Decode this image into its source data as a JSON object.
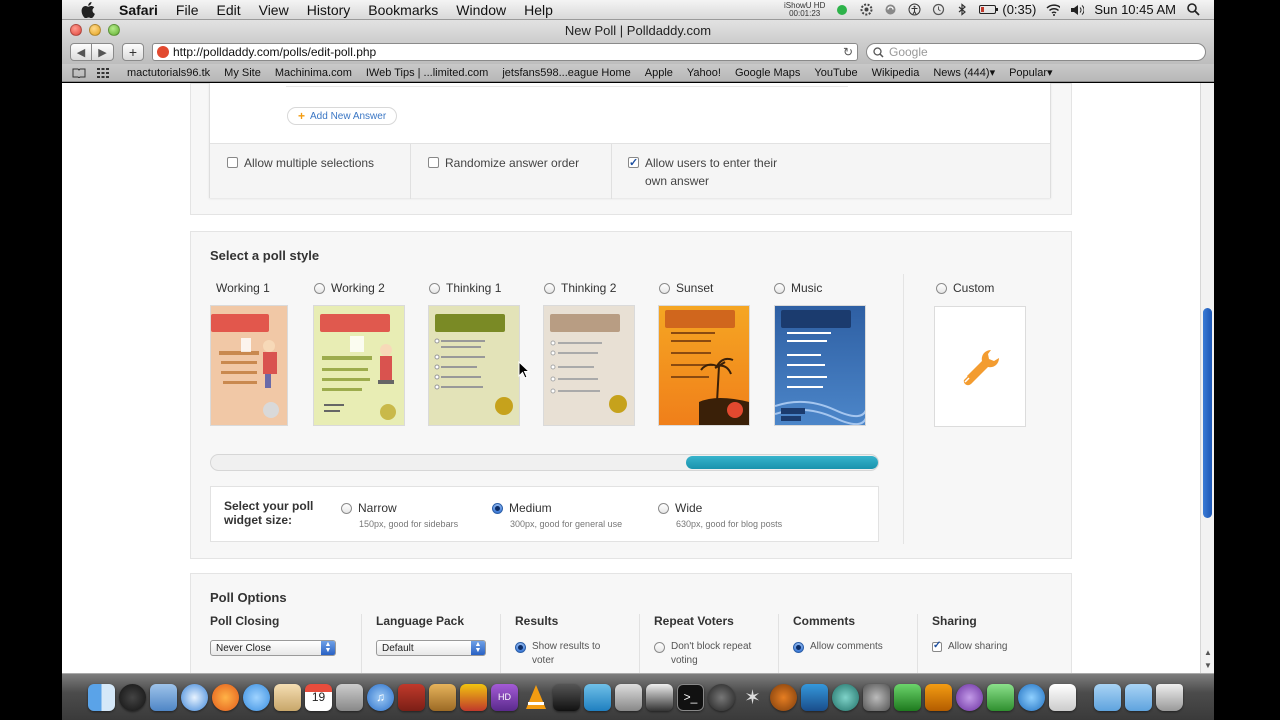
{
  "menubar": {
    "app": "Safari",
    "items": [
      "File",
      "Edit",
      "View",
      "History",
      "Bookmarks",
      "Window",
      "Help"
    ],
    "ishowu_label": "iShowU HD",
    "ishowu_time": "00:01:23",
    "battery": "(0:35)",
    "clock": "Sun 10:45 AM"
  },
  "window": {
    "title": "New Poll | Polldaddy.com"
  },
  "toolbar": {
    "url": "http://polldaddy.com/polls/edit-poll.php",
    "search_placeholder": "Google"
  },
  "bookmarks": [
    "mactutorials96.tk",
    "My Site",
    "Machinima.com",
    "IWeb Tips | ...limited.com",
    "jetsfans598...eague Home",
    "Apple",
    "Yahoo!",
    "Google Maps",
    "YouTube",
    "Wikipedia",
    "News (444)▾",
    "Popular▾"
  ],
  "answers": {
    "add_answer": "Add New Answer",
    "options": [
      {
        "label": "Allow multiple selections",
        "checked": false
      },
      {
        "label": "Randomize answer order",
        "checked": false
      },
      {
        "label": "Allow users to enter their own answer",
        "checked": true
      }
    ]
  },
  "poll_style": {
    "heading": "Select a poll style",
    "styles": [
      {
        "label": "Working 1",
        "bg": "#f1c8a6",
        "accent": "#e2574c"
      },
      {
        "label": "Working 2",
        "bg": "#e8edb4",
        "accent": "#e0594e"
      },
      {
        "label": "Thinking 1",
        "bg": "#e3e3b8",
        "accent": "#7a8a25"
      },
      {
        "label": "Thinking 2",
        "bg": "#e8e0d4",
        "accent": "#b89d83"
      },
      {
        "label": "Sunset",
        "bg": "#f5a623",
        "accent": "#d0661d"
      },
      {
        "label": "Music",
        "bg": "#2e5fa3",
        "accent": "#1b3b6e"
      }
    ],
    "custom_label": "Custom",
    "widget_size_label": "Select your poll widget size:",
    "sizes": [
      {
        "label": "Narrow",
        "desc": "150px, good for sidebars",
        "checked": false
      },
      {
        "label": "Medium",
        "desc": "300px, good for general use",
        "checked": true
      },
      {
        "label": "Wide",
        "desc": "630px, good for blog posts",
        "checked": false
      }
    ]
  },
  "poll_options": {
    "heading": "Poll Options",
    "closing": {
      "title": "Poll Closing",
      "value": "Never Close"
    },
    "language": {
      "title": "Language Pack",
      "value": "Default"
    },
    "results": {
      "title": "Results",
      "option": "Show results to voter"
    },
    "repeat": {
      "title": "Repeat Voters",
      "option": "Don't block repeat voting"
    },
    "comments": {
      "title": "Comments",
      "option": "Allow comments"
    },
    "sharing": {
      "title": "Sharing",
      "option": "Allow sharing"
    }
  },
  "dock_icons": [
    "finder-icon",
    "dashboard-icon",
    "mail-icon",
    "safari-icon",
    "firefox-icon",
    "ichat-icon",
    "preview-icon",
    "ical-icon",
    "iphoto-icon",
    "itunes-icon",
    "photo-booth-icon",
    "image-capture-icon",
    "garageband-icon",
    "hd-icon",
    "vlc-icon",
    "imovie-icon",
    "app-store-icon",
    "utility-icon",
    "clapper-icon",
    "terminal-icon",
    "aperture-icon",
    "sparkle-icon",
    "guitar-icon",
    "finalcut-icon",
    "network-icon",
    "system-prefs-icon",
    "leaf-icon",
    "plug-icon",
    "purple-app-icon",
    "people-icon",
    "globe-icon",
    "textedit-icon",
    "folder-icon",
    "folder-icon-2",
    "trash-icon"
  ]
}
